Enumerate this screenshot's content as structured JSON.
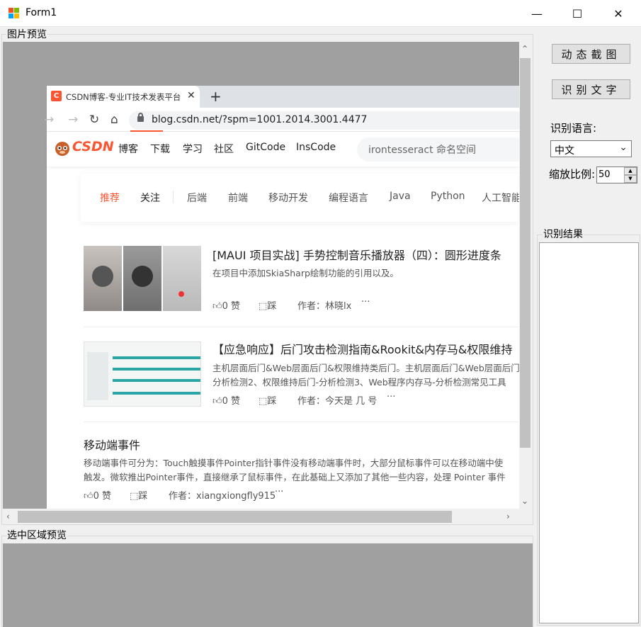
{
  "window": {
    "title": "Form1",
    "minimize": "—",
    "maximize": "☐",
    "close": "✕"
  },
  "preview_group": {
    "label": "图片预览"
  },
  "selection_group": {
    "label": "选中区域预览"
  },
  "right_panel": {
    "capture_button": "动态截图",
    "ocr_button": "识别文字",
    "language_label": "识别语言:",
    "language_value": "中文",
    "zoom_label": "缩放比例:",
    "zoom_value": "50",
    "result_label": "识别结果"
  },
  "browser": {
    "tab_title": "CSDN博客-专业IT技术发表平台",
    "tab_favicon": "C",
    "new_tab": "+",
    "url": "blog.csdn.net/?spm=1001.2014.3001.4477",
    "logo_text": "CSDN",
    "top_nav": [
      "博客",
      "下载",
      "学习",
      "社区",
      "GitCode",
      "InsCode"
    ],
    "search_placeholder": "irontesseract 命名空间",
    "categories": [
      "推荐",
      "关注",
      "后端",
      "前端",
      "移动开发",
      "编程语言",
      "Java",
      "Python",
      "人工智能"
    ],
    "articles": [
      {
        "title": "[MAUI 项目实战] 手势控制音乐播放器（四）：圆形进度条",
        "desc": "在项目中添加SkiaSharp绘制功能的引用以及。",
        "likes": "0 赞",
        "dislike": "踩",
        "author": "作者：林晓lx",
        "more": "···"
      },
      {
        "title": "【应急响应】后门攻击检测指南&Rookit&内存马&权限维持",
        "desc": "主机层面后门&Web层面后门&权限维持类后门。主机层面后门&Web层面后门",
        "desc2": "分析检测2、权限维持后门-分析检测3、Web程序内存马-分析检测常见工具",
        "likes": "0 赞",
        "dislike": "踩",
        "author": "作者：今天是 几 号",
        "more": "···"
      },
      {
        "title": "移动端事件",
        "desc": "移动端事件可分为：Touch触摸事件Pointer指针事件没有移动端事件时，大部分鼠标事件可以在移动端中使",
        "desc2": "触发。微软推出Pointer事件，直接继承了鼠标事件，在此基础上又添加了其他一些内容，处理 Pointer 事件",
        "likes": "0 赞",
        "dislike": "踩",
        "author": "作者：xiangxiongfly915",
        "more": "···"
      }
    ]
  },
  "colors": {
    "accent": "#fc5531",
    "preview_bg": "#a0a0a0"
  }
}
